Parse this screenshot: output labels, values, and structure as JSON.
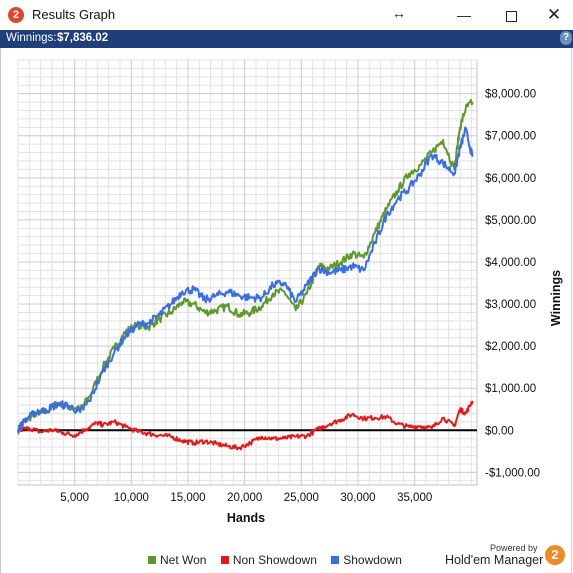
{
  "window": {
    "title": "Results Graph",
    "icon": "holdem-manager-2-icon",
    "resize_glyph": "↔",
    "minimize_glyph": "—",
    "close_glyph": "✕"
  },
  "infobar": {
    "label": "Winnings:",
    "value": "$7,836.02",
    "help_glyph": "?"
  },
  "chart_data": {
    "type": "line",
    "xlabel": "Hands",
    "ylabel": "Winnings",
    "xlim": [
      0,
      40500
    ],
    "ylim": [
      -1300,
      8800
    ],
    "x_ticks": [
      5000,
      10000,
      15000,
      20000,
      25000,
      30000,
      35000
    ],
    "x_tick_labels": [
      "5,000",
      "10,000",
      "15,000",
      "20,000",
      "25,000",
      "30,000",
      "35,000"
    ],
    "y_ticks": [
      -1000,
      0,
      1000,
      2000,
      3000,
      4000,
      5000,
      6000,
      7000,
      8000
    ],
    "y_tick_labels": [
      "-$1,000.00",
      "$0.00",
      "$1,000.00",
      "$2,000.00",
      "$3,000.00",
      "$4,000.00",
      "$5,000.00",
      "$6,000.00",
      "$7,000.00",
      "$8,000.00"
    ],
    "grid": true,
    "legend_position": "bottom",
    "series": [
      {
        "name": "Net Won",
        "color": "#5e9a2b",
        "x": [
          0,
          500,
          1500,
          2500,
          3500,
          4500,
          5500,
          6300,
          7500,
          8500,
          9500,
          10500,
          11500,
          12500,
          13500,
          14500,
          15500,
          16500,
          17500,
          18500,
          19500,
          20500,
          21500,
          22500,
          23500,
          24500,
          25500,
          26500,
          27500,
          28500,
          29500,
          30500,
          31500,
          32500,
          33500,
          34500,
          35500,
          36500,
          37500,
          38500,
          39000,
          39500,
          40100
        ],
        "values": [
          0,
          200,
          400,
          450,
          650,
          550,
          500,
          800,
          1500,
          1950,
          2350,
          2500,
          2450,
          2650,
          2800,
          3050,
          3000,
          2800,
          2850,
          2950,
          2750,
          2800,
          2950,
          3250,
          3300,
          2850,
          3250,
          3900,
          3850,
          4000,
          4200,
          4100,
          4700,
          5250,
          5700,
          6100,
          6300,
          6600,
          6900,
          6200,
          7200,
          7650,
          7800
        ]
      },
      {
        "name": "Non Showdown",
        "color": "#e41a1a",
        "x": [
          0,
          1000,
          2000,
          3000,
          4000,
          5000,
          6000,
          7000,
          7500,
          8500,
          9500,
          10500,
          11500,
          12500,
          13500,
          14500,
          15500,
          16500,
          17500,
          18500,
          19500,
          20500,
          21500,
          22500,
          23500,
          24500,
          25500,
          26500,
          27500,
          28500,
          29500,
          30500,
          31500,
          32500,
          33500,
          34500,
          35500,
          36500,
          37500,
          38500,
          39000,
          39500,
          40100
        ],
        "values": [
          0,
          50,
          -40,
          10,
          -60,
          -120,
          30,
          180,
          120,
          200,
          80,
          -20,
          -80,
          -120,
          -150,
          -250,
          -300,
          -260,
          -320,
          -380,
          -420,
          -300,
          -150,
          -200,
          -190,
          -150,
          -130,
          30,
          150,
          250,
          380,
          280,
          300,
          320,
          150,
          80,
          100,
          50,
          300,
          100,
          500,
          400,
          700
        ]
      },
      {
        "name": "Showdown",
        "color": "#3a6de8",
        "x": [
          0,
          500,
          1500,
          2500,
          3500,
          4500,
          5500,
          6300,
          7500,
          8500,
          9500,
          10500,
          11500,
          12500,
          13500,
          14500,
          15500,
          16500,
          17500,
          18500,
          19500,
          20500,
          21500,
          22500,
          23500,
          24500,
          25500,
          26500,
          27500,
          28500,
          29500,
          30500,
          31500,
          32500,
          33500,
          34500,
          35500,
          36500,
          37500,
          38500,
          39000,
          39500,
          40100
        ],
        "values": [
          0,
          200,
          420,
          480,
          620,
          580,
          430,
          700,
          1400,
          1850,
          2250,
          2500,
          2550,
          2750,
          3000,
          3300,
          3350,
          3100,
          3200,
          3300,
          3200,
          3150,
          3150,
          3450,
          3500,
          3050,
          3450,
          3850,
          3750,
          3800,
          3900,
          3800,
          4450,
          5100,
          5500,
          5750,
          6100,
          6550,
          6350,
          6100,
          6700,
          7150,
          6500
        ]
      }
    ]
  },
  "branding": {
    "powered_by": "Powered by",
    "product": "Hold'em Manager",
    "badge": "2"
  }
}
